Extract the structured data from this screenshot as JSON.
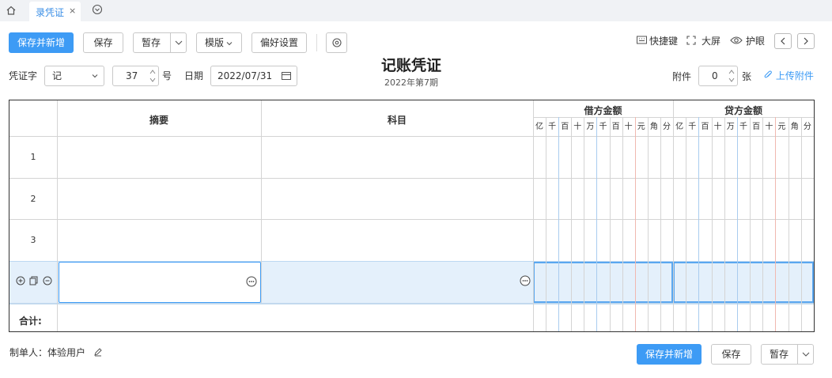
{
  "tabbar": {
    "home_icon": "home-icon",
    "tabs": [
      {
        "label": "录凭证",
        "close": "×"
      }
    ],
    "more_icon": "chevron-circle-down-icon"
  },
  "toolbar": {
    "save_new_label": "保存并新增",
    "save_label": "保存",
    "draft_label": "暂存",
    "template_label": "模版",
    "prefs_label": "偏好设置",
    "settings_icon": "gear-icon",
    "shortcut_label": "快捷键",
    "fullscreen_label": "大屏",
    "eyecare_label": "护眼"
  },
  "voucher": {
    "type_label": "凭证字",
    "type_value": "记",
    "number_value": "37",
    "number_suffix": "号",
    "date_label": "日期",
    "date_value": "2022/07/31",
    "title": "记账凭证",
    "period": "2022年第7期",
    "attach_label": "附件",
    "attach_value": "0",
    "attach_unit": "张",
    "upload_label": "上传附件"
  },
  "table": {
    "summary_header": "摘要",
    "subject_header": "科目",
    "debit_header": "借方金额",
    "credit_header": "贷方金额",
    "digits": [
      "亿",
      "千",
      "百",
      "十",
      "万",
      "千",
      "百",
      "十",
      "元",
      "角",
      "分"
    ],
    "rows": [
      "1",
      "2",
      "3"
    ],
    "total_label": "合计:"
  },
  "footer": {
    "maker_label": "制单人：体验用户",
    "save_new_label": "保存并新增",
    "save_label": "保存",
    "draft_label": "暂存"
  },
  "colors": {
    "primary": "#3d9bf5",
    "active_row": "#e4f0fb",
    "table_border": "#333333"
  }
}
